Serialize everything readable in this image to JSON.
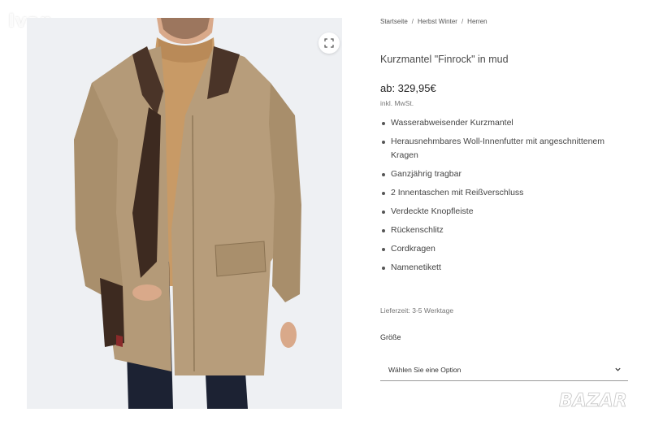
{
  "watermark_top": "Ivan",
  "watermark_bottom": "BAZAR",
  "breadcrumb": {
    "items": [
      "Startseite",
      "Herbst Winter",
      "Herren"
    ],
    "separator": "/"
  },
  "product": {
    "title": "Kurzmantel \"Finrock\" in mud",
    "price": "ab: 329,95€",
    "tax_note": "inkl. MwSt.",
    "features": [
      "Wasserabweisender Kurzmantel",
      "Herausnehmbares Woll-Innenfutter mit angeschnittenem Kragen",
      "Ganzjährig tragbar",
      "2 Innentaschen mit Reißverschluss",
      "Verdeckte Knopfleiste",
      "Rückenschlitz",
      "Cordkragen",
      "Namenetikett"
    ],
    "delivery": "Lieferzeit: 3-5 Werktage",
    "size_label": "Größe",
    "size_select_placeholder": "Wählen Sie eine Option"
  },
  "icons": {
    "zoom": "expand-icon",
    "select_arrow": "chevron-down-icon"
  },
  "colors": {
    "coat": "#b49a78",
    "collar": "#4a3428",
    "sweater": "#c89a66",
    "pants": "#1c2233",
    "background": "#eef0f3"
  }
}
